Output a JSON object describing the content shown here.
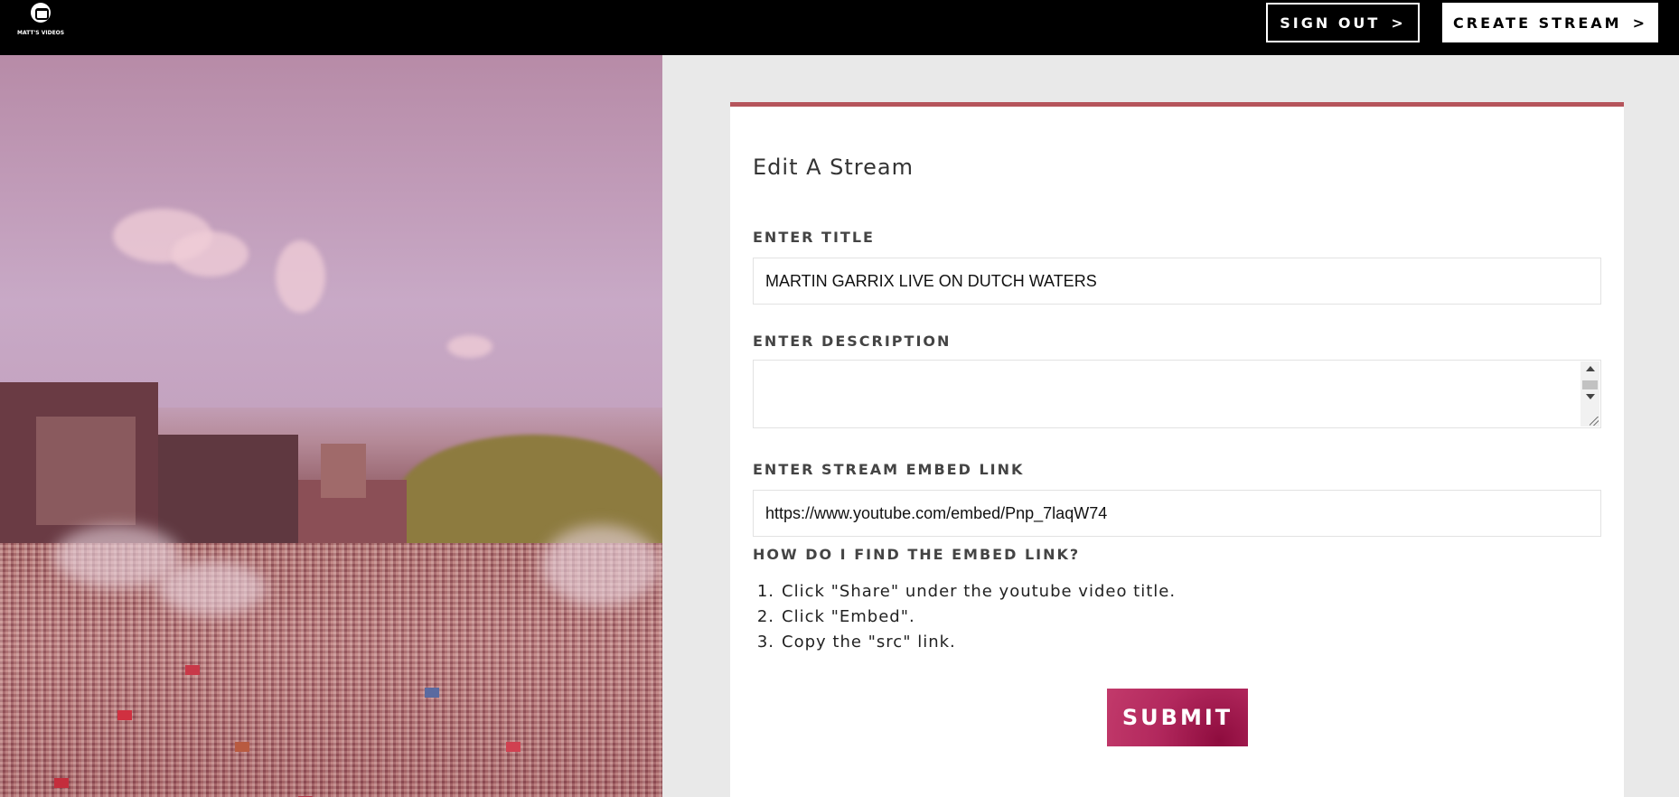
{
  "header": {
    "logo_text": "MATT'S VIDEOS",
    "signout_label": "SIGN OUT",
    "create_stream_label": "CREATE STREAM",
    "chevron": ">"
  },
  "form": {
    "title": "Edit A Stream",
    "title_label": "ENTER TITLE",
    "title_value": "MARTIN GARRIX LIVE ON DUTCH WATERS",
    "description_label": "ENTER DESCRIPTION",
    "description_value": "",
    "embed_label": "ENTER STREAM EMBED LINK",
    "embed_value": "https://www.youtube.com/embed/Pnp_7laqW74",
    "help_label": "HOW DO I FIND THE EMBED LINK?",
    "steps": [
      {
        "num": "1.",
        "text": "Click \"Share\" under the youtube video title."
      },
      {
        "num": "2.",
        "text": "Click \"Embed\"."
      },
      {
        "num": "3.",
        "text": "Copy the \"src\" link."
      }
    ],
    "submit_label": "SUBMIT"
  },
  "colors": {
    "topbar": "#000000",
    "card_accent": "#b5545b",
    "submit": "#b2285d",
    "page_bg": "#e9e9e9"
  },
  "icons": {
    "logo": "logo-icon"
  }
}
